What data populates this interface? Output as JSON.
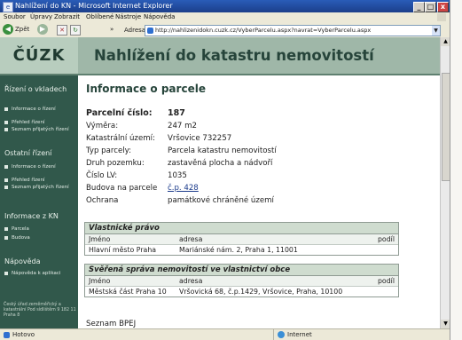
{
  "window": {
    "title": "Nahlížení do KN - Microsoft Internet Explorer",
    "app_icon": "e",
    "buttons": {
      "minimize": "_",
      "maximize": "□",
      "close": "x"
    }
  },
  "menu": [
    "Soubor",
    "Úpravy",
    "Zobrazit",
    "Oblíbené",
    "Nástroje",
    "Nápověda"
  ],
  "toolbar": {
    "back_label": "Zpět",
    "back_glyph": "◀",
    "forward_glyph": "▶",
    "stop_glyph": "✕",
    "refresh_glyph": "↻",
    "address_label": "Adresa",
    "address_value": "http://nahlizenidokn.cuzk.cz/VyberParcelu.aspx?navrat=VyberParcelu.aspx"
  },
  "header": {
    "logo": "ČÚZK",
    "title": "Nahlížení do katastru nemovitostí"
  },
  "sidebar": {
    "sections": [
      {
        "title": "Řízení o vkladech",
        "items": [
          "Informace o řízení",
          "Přehled řízení",
          "Seznam přijatých řízení"
        ]
      },
      {
        "title": "Ostatní řízení",
        "items": [
          "Informace o řízení",
          "Přehled řízení",
          "Seznam přijatých řízení"
        ]
      },
      {
        "title": "Informace z KN",
        "items": [
          "Parcela",
          "Budova"
        ]
      },
      {
        "title": "Nápověda",
        "items": [
          "Nápověda k aplikaci"
        ]
      }
    ],
    "footer": "Český úřad zeměměřický a katastrální Pod sídlištěm 9 182 11 Praha 8"
  },
  "content": {
    "title": "Informace o parcele",
    "fields": [
      {
        "key": "Parcelní číslo:",
        "value": "187"
      },
      {
        "key": "Výměra:",
        "value": "247 m2"
      },
      {
        "key": "Katastrální území:",
        "value": "Vršovice 732257"
      },
      {
        "key": "Typ parcely:",
        "value": "Parcela katastru nemovitostí"
      },
      {
        "key": "Druh pozemku:",
        "value": "zastavěná plocha a nádvoří"
      },
      {
        "key": "Číslo LV:",
        "value": "1035"
      },
      {
        "key": "Budova na parcele",
        "value": "č.p. 428"
      },
      {
        "key": "Ochrana",
        "value": "památkové chráněné území"
      }
    ],
    "table1": {
      "heading": "Vlastnické právo",
      "columns": [
        "Jméno",
        "adresa",
        "podíl"
      ],
      "rows": [
        [
          "Hlavní město Praha",
          "Mariánské nám. 2, Praha 1, 11001",
          ""
        ]
      ]
    },
    "table2": {
      "heading": "Svěřená správa nemovitostí ve vlastnictví obce",
      "columns": [
        "Jméno",
        "adresa",
        "podíl"
      ],
      "rows": [
        [
          "Městská část Praha 10",
          "Vršovická 68, č.p.1429, Vršovice, Praha, 10100",
          ""
        ]
      ]
    },
    "bottom_link": "Seznam BPEJ"
  },
  "statusbar": {
    "status": "Hotovo",
    "zone": "Internet"
  }
}
